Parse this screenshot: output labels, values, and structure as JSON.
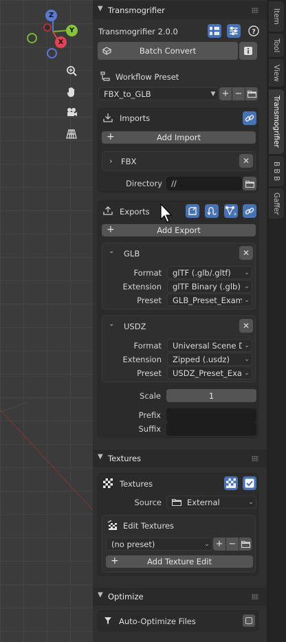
{
  "viewport": {
    "gizmo": {
      "z": "Z",
      "y": "Y",
      "x": "X"
    }
  },
  "tabs": [
    "Item",
    "Tool",
    "View",
    "Transmogrifier",
    "B B B",
    "Gaffer"
  ],
  "active_tab": "Transmogrifier",
  "transmogrifier": {
    "header": "Transmogrifier",
    "version": "Transmogrifier 2.0.0",
    "batch_convert": "Batch Convert",
    "workflow_label": "Workflow Preset",
    "workflow_value": "FBX_to_GLB"
  },
  "imports": {
    "title": "Imports",
    "add_label": "Add Import",
    "item_label": "FBX",
    "directory_label": "Directory",
    "directory_value": "//"
  },
  "exports": {
    "title": "Exports",
    "add_label": "Add Export",
    "field_labels": {
      "format": "Format",
      "extension": "Extension",
      "preset": "Preset"
    },
    "glb": {
      "title": "GLB",
      "format": "glTF (.glb/.gltf)",
      "extension": "glTF Binary (.glb)",
      "preset": "GLB_Preset_Example"
    },
    "usdz": {
      "title": "USDZ",
      "format": "Universal Scene D...",
      "extension": "Zipped (.usdz)",
      "preset": "USDZ_Preset_Exa..."
    },
    "scale_label": "Scale",
    "scale_value": "1",
    "prefix_label": "Prefix",
    "prefix_value": "",
    "suffix_label": "Suffix",
    "suffix_value": ""
  },
  "textures_section": {
    "header": "Textures",
    "box_title": "Textures",
    "source_label": "Source",
    "source_value": "External",
    "edit_title": "Edit Textures",
    "preset_value": "(no preset)",
    "add_label": "Add Texture Edit"
  },
  "optimize_section": {
    "header": "Optimize",
    "auto_optimize_label": "Auto-Optimize Files"
  },
  "colors": {
    "accent_blue": "#4772b3",
    "panel_bg": "#303030"
  }
}
